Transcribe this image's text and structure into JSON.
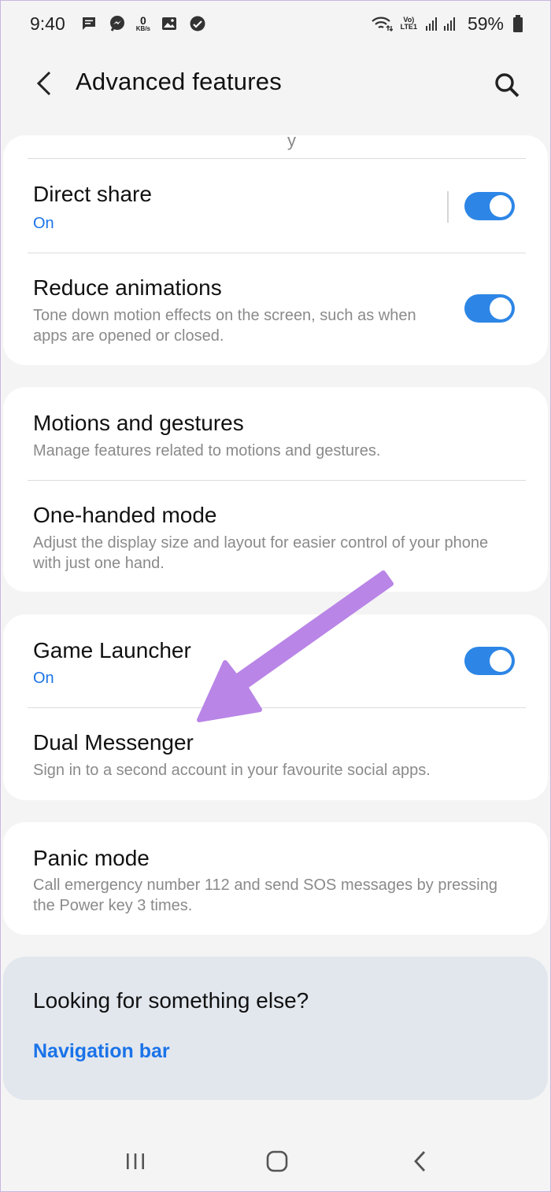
{
  "status_bar": {
    "time": "9:40",
    "data_speed_value": "0",
    "data_speed_unit": "KB/s",
    "volte_top": "Vo)",
    "volte_bottom": "LTE1",
    "battery": "59%",
    "icons": [
      "message-icon",
      "messenger-icon",
      "image-icon",
      "check-circle-icon",
      "wifi-icon",
      "signal-icon",
      "battery-icon"
    ]
  },
  "app_bar": {
    "title": "Advanced features"
  },
  "groups": {
    "group1": {
      "direct_share": {
        "title": "Direct share",
        "status": "On",
        "enabled": true
      },
      "reduce_animations": {
        "title": "Reduce animations",
        "subtitle": "Tone down motion effects on the screen, such as when apps are opened or closed.",
        "enabled": true
      }
    },
    "group2": {
      "motions_gestures": {
        "title": "Motions and gestures",
        "subtitle": "Manage features related to motions and gestures."
      },
      "one_handed": {
        "title": "One-handed mode",
        "subtitle": "Adjust the display size and layout for easier control of your phone with just one hand."
      }
    },
    "group3": {
      "game_launcher": {
        "title": "Game Launcher",
        "status": "On",
        "enabled": true
      },
      "dual_messenger": {
        "title": "Dual Messenger",
        "subtitle": "Sign in to a second account in your favourite social apps."
      }
    },
    "group4": {
      "panic_mode": {
        "title": "Panic mode",
        "subtitle": "Call emergency number 112 and send SOS messages by pressing the Power key 3 times."
      }
    }
  },
  "suggestions": {
    "title": "Looking for something else?",
    "link": "Navigation bar"
  },
  "colors": {
    "accent": "#2d86e6",
    "link": "#1a73e8",
    "arrow": "#b985e6"
  }
}
